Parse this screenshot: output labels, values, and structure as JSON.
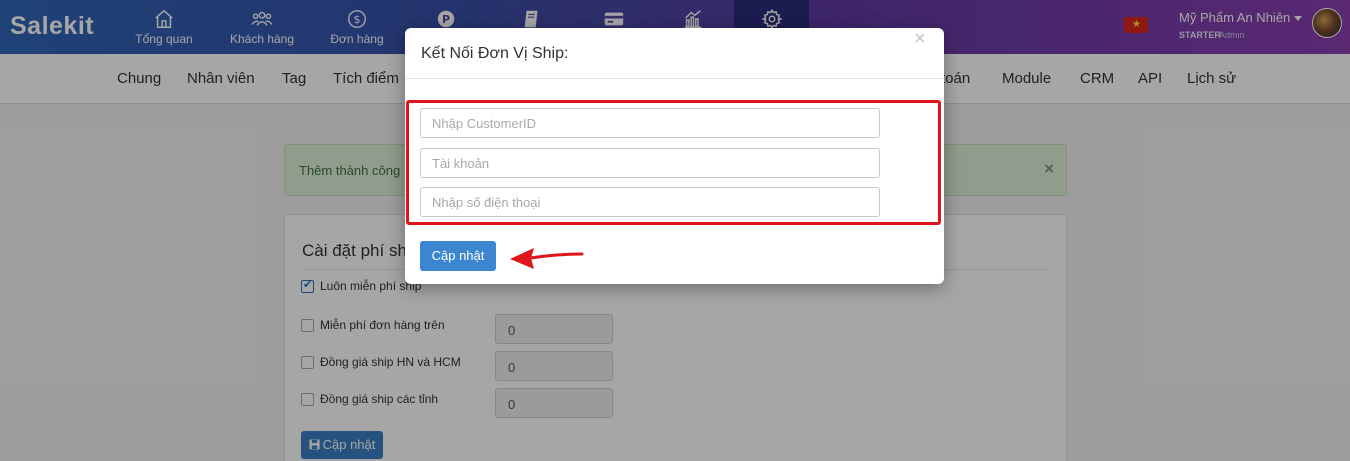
{
  "app": {
    "logo": "Salekit"
  },
  "topnav": {
    "items": [
      {
        "label": "Tổng quan",
        "icon": "home-icon"
      },
      {
        "label": "Khách hàng",
        "icon": "customers-icon"
      },
      {
        "label": "Đơn hàng",
        "icon": "dollar-icon"
      },
      {
        "label": "",
        "icon": "points-icon"
      },
      {
        "label": "",
        "icon": "book-icon"
      },
      {
        "label": "",
        "icon": "card-icon"
      },
      {
        "label": "",
        "icon": "chart-icon"
      },
      {
        "label": "",
        "icon": "gear-icon",
        "active": true
      }
    ],
    "flag_star": "★",
    "shop_name": "Mỹ Phẩm An Nhiên",
    "plan": "STARTER",
    "role": "Admin"
  },
  "subnav": {
    "tabs": [
      "Chung",
      "Nhân viên",
      "Tag",
      "Tích điểm",
      "toán",
      "Module",
      "CRM",
      "API",
      "Lịch sử"
    ]
  },
  "alert": {
    "text": "Thêm thành công",
    "close": "×"
  },
  "shipping": {
    "title": "Cài đặt phí ship",
    "options": [
      {
        "label": "Luôn miễn phí ship",
        "checked": true
      },
      {
        "label": "Miễn phí đơn hàng trên",
        "checked": false,
        "value": "0"
      },
      {
        "label": "Đồng giá ship HN và HCM",
        "checked": false,
        "value": "0"
      },
      {
        "label": "Đồng giá ship các tỉnh",
        "checked": false,
        "value": "0"
      }
    ],
    "save_label": "Cập nhật"
  },
  "modal": {
    "title": "Kết Nối Đơn Vị Ship:",
    "close": "×",
    "fields": {
      "customer_id_placeholder": "Nhập CustomerID",
      "account_placeholder": "Tài khoản",
      "phone_placeholder": "Nhập số điện thoại"
    },
    "submit_label": "Cập nhật"
  },
  "colors": {
    "highlight": "#e0141b",
    "primary_button": "#3b86cf"
  }
}
